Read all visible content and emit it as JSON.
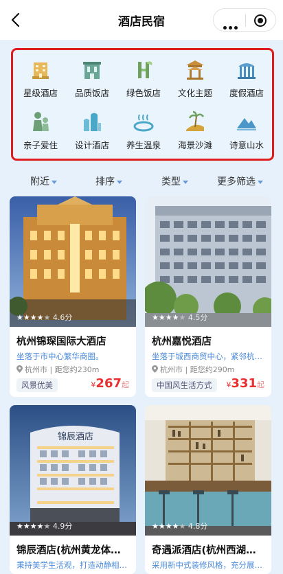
{
  "nav": {
    "title": "酒店民宿",
    "back_icon": "chevron-left-icon",
    "more_icon": "more-dots-icon",
    "close_icon": "target-icon"
  },
  "categories": [
    {
      "label": "星级酒店",
      "icon": "star-hotel-icon",
      "color": "#d9a94b"
    },
    {
      "label": "品质饭店",
      "icon": "quality-hotel-icon",
      "color": "#5e9a8c"
    },
    {
      "label": "绿色饭店",
      "icon": "green-hotel-icon",
      "color": "#6fa05e"
    },
    {
      "label": "文化主题",
      "icon": "pavilion-icon",
      "color": "#c98f3a"
    },
    {
      "label": "度假酒店",
      "icon": "resort-icon",
      "color": "#4a8fc2"
    },
    {
      "label": "亲子爱住",
      "icon": "family-icon",
      "color": "#6c9f76"
    },
    {
      "label": "设计酒店",
      "icon": "design-hotel-icon",
      "color": "#4aa7c8"
    },
    {
      "label": "养生温泉",
      "icon": "hot-spring-icon",
      "color": "#4aa7c8"
    },
    {
      "label": "海景沙滩",
      "icon": "beach-icon",
      "color": "#d4a43a"
    },
    {
      "label": "诗意山水",
      "icon": "mountain-icon",
      "color": "#4a96c8"
    }
  ],
  "filters": [
    {
      "label": "附近"
    },
    {
      "label": "排序"
    },
    {
      "label": "类型"
    },
    {
      "label": "更多筛选"
    }
  ],
  "hotels": [
    {
      "name": "杭州锦琛国际大酒店",
      "rating": "4.6分",
      "stars": 4,
      "desc": "坐落于市中心繁华商圈。",
      "location": "杭州市 | 距您约230m",
      "tag": "风景优美",
      "price_symbol": "¥",
      "price": "267",
      "price_suffix": "起"
    },
    {
      "name": "杭州嘉悦酒店",
      "rating": "4.5分",
      "stars": 4,
      "desc": "坐落于城西商贸中心，紧邻杭…",
      "location": "杭州市 | 距您约290m",
      "tag": "中国风生活方式",
      "price_symbol": "¥",
      "price": "331",
      "price_suffix": "起"
    },
    {
      "name": "锦辰酒店(杭州黄龙体…",
      "rating": "4.9分",
      "stars": 4,
      "desc": "秉持美学生活观，打造动静相…",
      "sign_text": "锦辰酒店"
    },
    {
      "name": "奇遇派酒店(杭州西湖…",
      "rating": "4.8分",
      "stars": 4,
      "desc": "采用新中式装修风格，充分展…"
    }
  ]
}
